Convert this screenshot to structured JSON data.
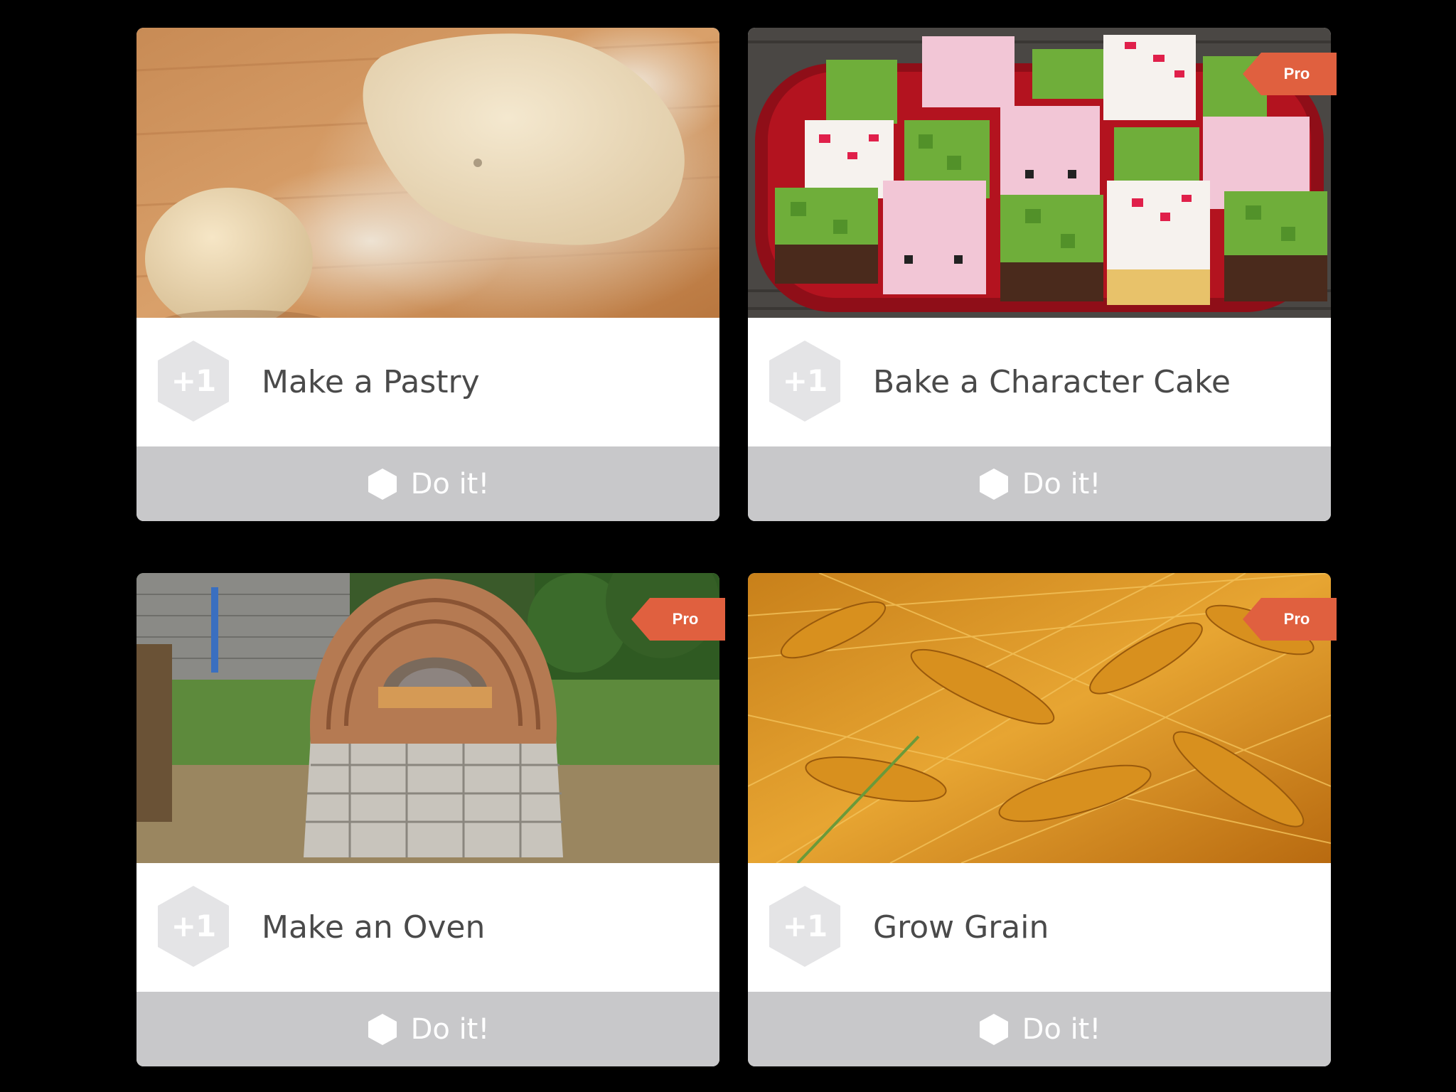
{
  "cards": [
    {
      "title": "Make a Pastry",
      "badge": "+1",
      "action_label": "Do it!",
      "pro": false,
      "photo": "pastry-dough-photo"
    },
    {
      "title": "Bake a Character Cake",
      "badge": "+1",
      "action_label": "Do it!",
      "pro": true,
      "pro_label": "Pro",
      "photo": "character-cakes-photo"
    },
    {
      "title": "Make an Oven",
      "badge": "+1",
      "action_label": "Do it!",
      "pro": true,
      "pro_label": "Pro",
      "photo": "cob-oven-photo"
    },
    {
      "title": "Grow Grain",
      "badge": "+1",
      "action_label": "Do it!",
      "pro": true,
      "pro_label": "Pro",
      "photo": "wheat-field-photo"
    }
  ],
  "colors": {
    "background": "#000000",
    "pro_tag": "#e0603f",
    "badge_hex": "#e4e4e6",
    "action_bar": "#c8c8ca",
    "title_text": "#4a4a4a"
  },
  "icons": {
    "badge": "hexagon-icon",
    "action": "hexagon-icon"
  }
}
